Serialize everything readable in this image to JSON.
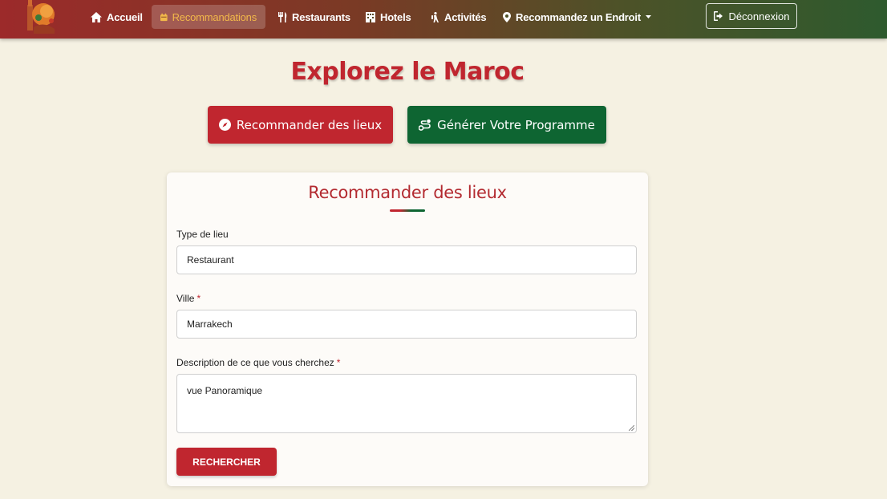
{
  "nav": {
    "items": [
      {
        "label": "Accueil",
        "icon": "home-icon"
      },
      {
        "label": "Recommandations",
        "icon": "calendar-icon",
        "active": true
      },
      {
        "label": "Restaurants",
        "icon": "utensils-icon"
      },
      {
        "label": "Hotels",
        "icon": "building-icon"
      },
      {
        "label": "Activités",
        "icon": "person-hiking-icon"
      },
      {
        "label": "Recommandez un Endroit",
        "icon": "map-pin-icon",
        "dropdown": true
      }
    ],
    "logout_label": "Déconnexion",
    "active_color": "#f2b84a"
  },
  "page": {
    "title": "Explorez le Maroc",
    "recommend_button": "Recommander des lieux",
    "generate_button": "Générer Votre Programme"
  },
  "form": {
    "title": "Recommander des lieux",
    "type_label": "Type de lieu",
    "type_value": "Restaurant",
    "city_label": "Ville",
    "city_value": "Marrakech",
    "description_label": "Description de ce que vous cherchez",
    "description_value": "vue Panoramique",
    "required_mark": "*",
    "submit_label": "RECHERCHER"
  },
  "colors": {
    "primary_red": "#c0262f",
    "primary_green": "#0e6532",
    "background": "#f5f1e2"
  }
}
